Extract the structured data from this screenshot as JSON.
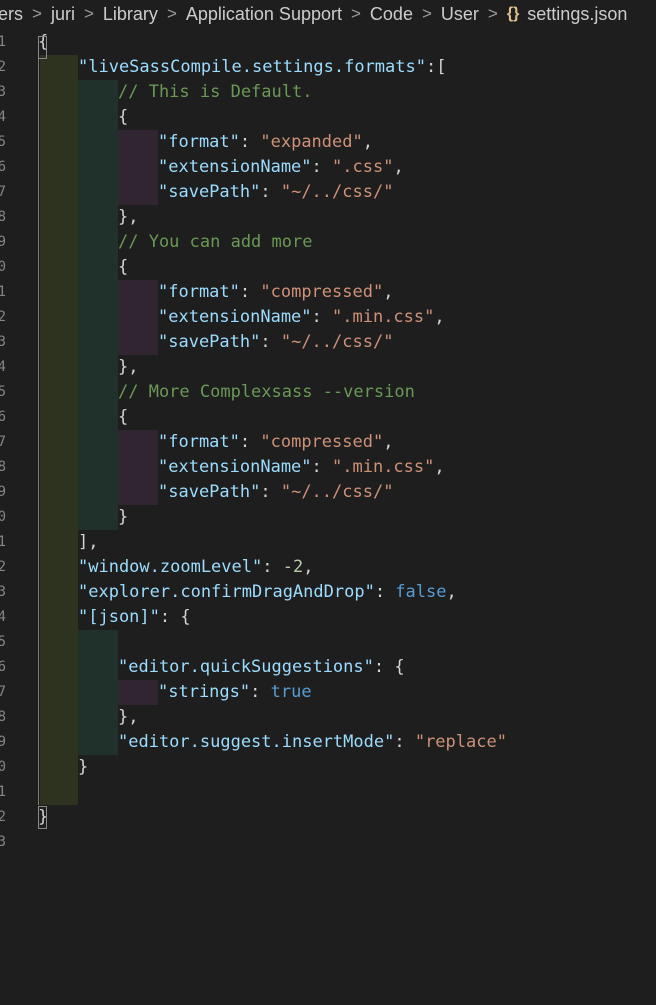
{
  "breadcrumb": {
    "items": [
      "ers",
      "juri",
      "Library",
      "Application Support",
      "Code",
      "User"
    ],
    "separator": ">",
    "file_icon": "{}",
    "file_name": "settings.json"
  },
  "gutter": {
    "line_numbers": [
      "1",
      "2",
      "3",
      "4",
      "5",
      "6",
      "7",
      "8",
      "9",
      "0",
      "1",
      "2",
      "3",
      "4",
      "5",
      "6",
      "7",
      "8",
      "9",
      "0",
      "1",
      "2",
      "3",
      "4",
      "5",
      "6",
      "7",
      "8",
      "9",
      "0",
      "1",
      "2",
      "3"
    ]
  },
  "code": {
    "l1_open": "{",
    "l2_key": "\"liveSassCompile.settings.formats\"",
    "l2_rest": ":[",
    "l3_comment": "// This is Default.",
    "l4_open": "{",
    "l5_key": "\"format\"",
    "l5_val": "\"expanded\"",
    "l6_key": "\"extensionName\"",
    "l6_val": "\".css\"",
    "l7_key": "\"savePath\"",
    "l7_val": "\"~/../css/\"",
    "l8_close": "},",
    "l9_comment": "// You can add more",
    "l10_open": "{",
    "l11_key": "\"format\"",
    "l11_val": "\"compressed\"",
    "l12_key": "\"extensionName\"",
    "l12_val": "\".min.css\"",
    "l13_key": "\"savePath\"",
    "l13_val": "\"~/../css/\"",
    "l14_close": "},",
    "l15_comment": "// More Complexsass --version",
    "l16_open": "{",
    "l17_key": "\"format\"",
    "l17_val": "\"compressed\"",
    "l18_key": "\"extensionName\"",
    "l18_val": "\".min.css\"",
    "l19_key": "\"savePath\"",
    "l19_val": "\"~/../css/\"",
    "l20_close": "}",
    "l21_close": "],",
    "l22_key": "\"window.zoomLevel\"",
    "l22_val": "-2",
    "l23_key": "\"explorer.confirmDragAndDrop\"",
    "l23_val": "false",
    "l24_key": "\"[json]\"",
    "l24_rest": ": {",
    "l26_key": "\"editor.quickSuggestions\"",
    "l26_rest": ": {",
    "l27_key": "\"strings\"",
    "l27_val": "true",
    "l28_close": "},",
    "l29_key": "\"editor.suggest.insertMode\"",
    "l29_val": "\"replace\"",
    "l30_close": "}",
    "l33_close": "}"
  },
  "colors": {
    "background": "#1e1e1e",
    "key": "#9cdcfe",
    "string": "#ce9178",
    "comment": "#6a9955",
    "keyword": "#569cd6",
    "number": "#b5cea8",
    "punctuation": "#d4d4d4",
    "indent_level_1": "#2e3320",
    "indent_level_2": "#20302a",
    "indent_level_3": "#302531"
  }
}
